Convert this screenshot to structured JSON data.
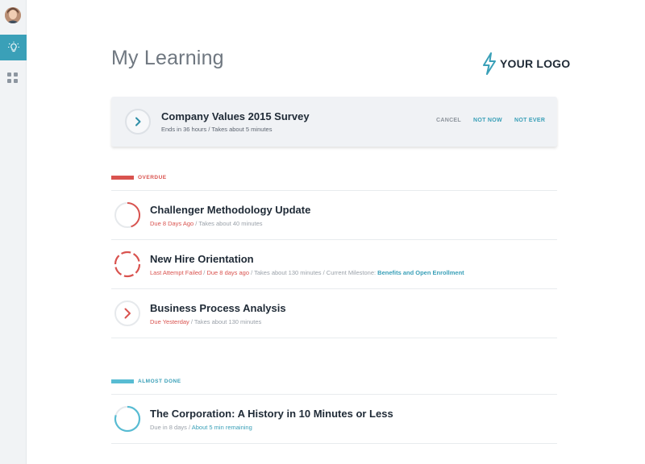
{
  "page": {
    "title": "My Learning"
  },
  "logo": {
    "text": "YOUR LOGO"
  },
  "colors": {
    "accent": "#3aa0b8",
    "overdue": "#d9534f",
    "almost_done": "#58bcd3"
  },
  "survey": {
    "title": "Company Values 2015 Survey",
    "subtitle": "Ends in 36 hours / Takes about 5 minutes",
    "actions": {
      "cancel": "CANCEL",
      "not_now": "NOT NOW",
      "not_ever": "NOT EVER"
    }
  },
  "sections": {
    "overdue": {
      "label": "OVERDUE",
      "items": [
        {
          "title": "Challenger Methodology Update",
          "due": "Due 8 Days Ago",
          "sep": " / ",
          "duration": "Takes about 40 minutes",
          "progress": 0.45
        },
        {
          "title": "New Hire Orientation",
          "failed": "Last Attempt Failed",
          "due": "Due 8 days ago",
          "sep": " / ",
          "duration": "Takes about 130 minutes",
          "milestone_label": "Current Milestone:",
          "milestone": "Benefits and Open Enrollment",
          "progress": 0.0
        },
        {
          "title": "Business Process Analysis",
          "due": "Due Yesterday",
          "sep": " / ",
          "duration": "Takes about 130 minutes",
          "progress": 0.0
        }
      ]
    },
    "almost_done": {
      "label": "ALMOST DONE",
      "items": [
        {
          "title": "The Corporation: A History in 10 Minutes or Less",
          "due": "Due in 8 days",
          "sep": " / ",
          "remaining": "About 5 min remaining",
          "progress": 0.8
        }
      ]
    }
  },
  "icons": {
    "nav_learning": "lightbulb-icon",
    "nav_apps": "grid-icon",
    "logo": "lightning-bolt-icon"
  }
}
